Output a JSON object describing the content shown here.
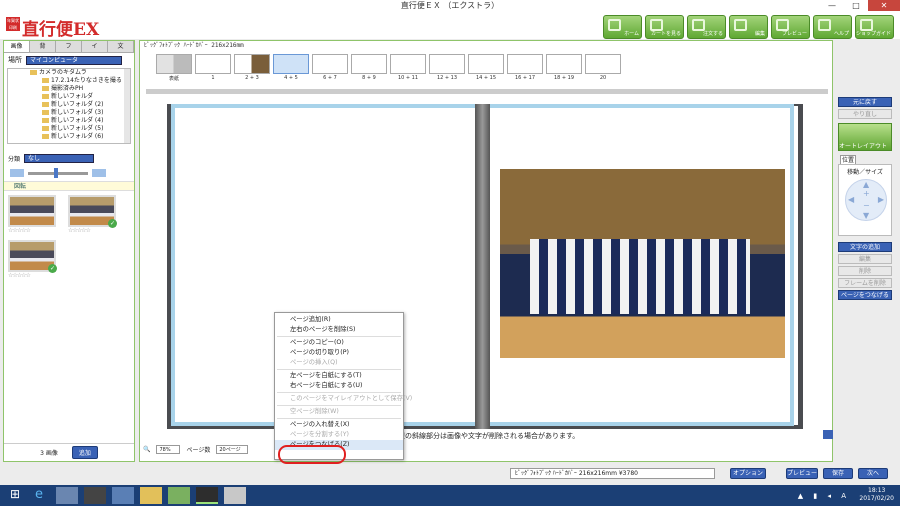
{
  "window": {
    "title": "直行便ＥＸ （エクストラ）",
    "min": "—",
    "max": "□",
    "close": "✕"
  },
  "brand": {
    "badge": "年賀状 印刷",
    "logo": "直行便EX"
  },
  "toolbar": [
    {
      "label": "ホーム",
      "icon": "home-icon"
    },
    {
      "label": "カートを見る",
      "icon": "cart-icon"
    },
    {
      "label": "注文する",
      "icon": "order-icon"
    },
    {
      "label": "編集",
      "icon": "edit-icon"
    },
    {
      "label": "プレビュー",
      "icon": "preview-icon"
    },
    {
      "label": "ヘルプ",
      "icon": "help-icon"
    },
    {
      "label": "ショップガイド",
      "icon": "guide-icon"
    }
  ],
  "left_panel": {
    "tabs": [
      "画像",
      "背",
      "フ",
      "イ",
      "文"
    ],
    "location_label": "場所",
    "location_value": "マイコンピュータ",
    "tree": [
      "カメラのキタムラ",
      "17.2.14たりなさきを撮る",
      "撮影済みPH",
      "新しいフォルダ",
      "新しいフォルダ (2)",
      "新しいフォルダ (3)",
      "新しいフォルダ (4)",
      "新しいフォルダ (5)",
      "新しいフォルダ (6)"
    ],
    "sort_label": "分類",
    "sort_value": "なし",
    "folder_header": "図転",
    "images": [
      {
        "stars": "☆☆☆☆☆",
        "checked": false
      },
      {
        "stars": "☆☆☆☆☆",
        "checked": true
      },
      {
        "stars": "☆☆☆☆☆",
        "checked": true
      }
    ],
    "count": "3 画像",
    "add_button": "追加"
  },
  "editor": {
    "title": "ﾋﾟｯｸﾞﾌｫﾄﾌﾞｯｸ ﾊｰﾄﾞｶﾊﾞｰ 216x216mm",
    "pages": [
      "表紙",
      "1",
      "2 + 3",
      "4 + 5",
      "6 + 7",
      "8 + 9",
      "10 + 11",
      "12 + 13",
      "14 + 15",
      "16 + 17",
      "18 + 19",
      "20"
    ],
    "notice": "エリア周辺の斜線部分は画像や文字が削除される場合があります。",
    "zoom_value": "78%",
    "page_count_label": "ページ数",
    "page_count_value": "20ページ"
  },
  "context_menu": [
    {
      "label": "ページ追加(R)",
      "enabled": true
    },
    {
      "label": "左右のページを削除(S)",
      "enabled": true
    },
    {
      "sep": true
    },
    {
      "label": "ページのコピー(O)",
      "enabled": true
    },
    {
      "label": "ページの切り取り(P)",
      "enabled": true
    },
    {
      "label": "ページの挿入(Q)",
      "enabled": false
    },
    {
      "sep": true
    },
    {
      "label": "左ページを白紙にする(T)",
      "enabled": true
    },
    {
      "label": "右ページを白紙にする(U)",
      "enabled": true
    },
    {
      "sep": true
    },
    {
      "label": "このページをマイレイアウトとして保存(V)",
      "enabled": false
    },
    {
      "sep": true
    },
    {
      "label": "空ページ削除(W)",
      "enabled": false
    },
    {
      "sep": true
    },
    {
      "label": "ページの入れ替え(X)",
      "enabled": true
    },
    {
      "label": "ページを分割する(Y)",
      "enabled": false
    },
    {
      "label": "ページをつなげる(Z)",
      "enabled": true
    }
  ],
  "right_panel": {
    "undo": "元に戻す",
    "redo": "やり直し",
    "auto_layout": "オートレイアウト",
    "position_tab": "位置",
    "move_size": "移動／サイズ",
    "add_text": "文字の追加",
    "edit": "編集",
    "delete": "削除",
    "frame_delete": "フレームを削除",
    "join_pages": "ページをつなげる"
  },
  "status": {
    "product": "ﾋﾟｯｸﾞﾌｫﾄﾌﾞｯｸ ﾊｰﾄﾞｶﾊﾞｰ 216x216mm ¥3780",
    "options": "オプション",
    "preview": "プレビュー",
    "save": "保存",
    "next": "次へ"
  },
  "taskbar": {
    "time": "18:13",
    "date": "2017/02/20",
    "ime": "A"
  }
}
